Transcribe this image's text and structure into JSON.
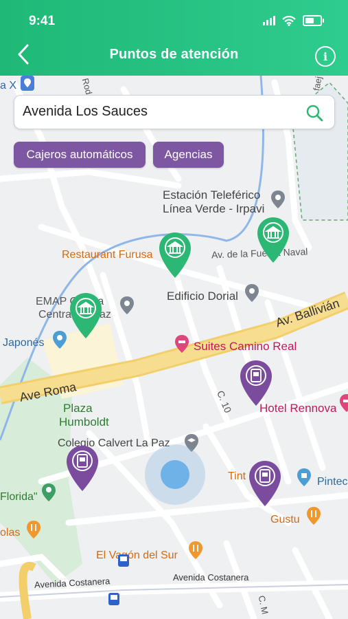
{
  "status_bar": {
    "time": "9:41"
  },
  "header": {
    "title": "Puntos de atención"
  },
  "search": {
    "value": "Avenida Los Sauces"
  },
  "filters": [
    {
      "label": "Cajeros automáticos"
    },
    {
      "label": "Agencias"
    }
  ],
  "map": {
    "street_labels": {
      "ave_roma": "Ave Roma",
      "av_ballivian": "Av. Ballivián",
      "c10": "C. 10",
      "costanera_1": "Avenida Costanera",
      "costanera_2": "Avenida Costanera",
      "fuerza_naval": "Av. de la Fuerza Naval",
      "rod": "Rod",
      "ma": "C. M",
      "fae": "faej",
      "ax": "a X"
    },
    "places": {
      "estacion_1": "Estación Teleférico",
      "estacion_2": "Línea Verde - Irpavi",
      "restaurant": "Restaurant Furusa",
      "edificio": "Edificio Dorial",
      "emap_1": "EMAP Oficina",
      "emap_2": "Central La Paz",
      "japones": "Japonés",
      "suites": "Suites Camino Real",
      "hotel": "Hotel Rennova",
      "plaza_1": "Plaza",
      "plaza_2": "Humboldt",
      "colegio": "Colegio Calvert La Paz",
      "florida": "Florida\"",
      "tint": "Tint",
      "pintec": "Pintec",
      "olas": "olas",
      "gustu": "Gustu",
      "vagon": "El Vagón del Sur"
    }
  }
}
